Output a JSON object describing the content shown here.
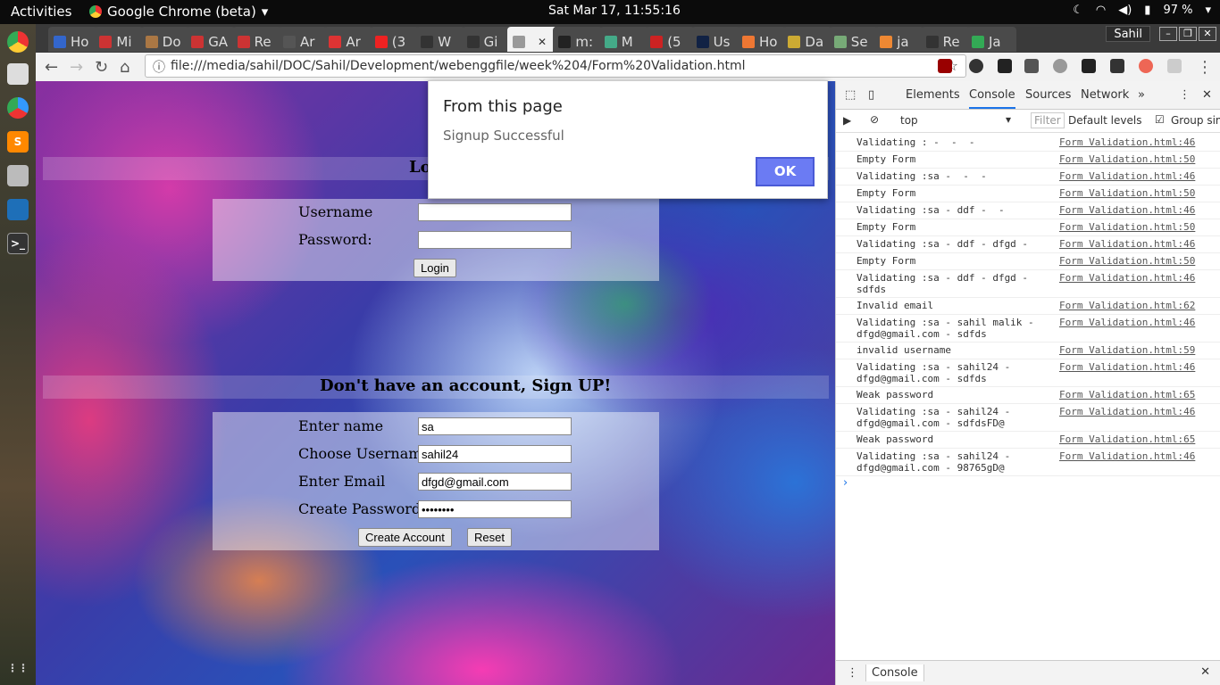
{
  "topbar": {
    "activities": "Activities",
    "app": "Google Chrome (beta)",
    "clock": "Sat Mar 17, 11:55:16",
    "battery": "97 %"
  },
  "browser": {
    "tabs": [
      {
        "label": "Ho"
      },
      {
        "label": "Mi"
      },
      {
        "label": "Do"
      },
      {
        "label": "GA"
      },
      {
        "label": "Re"
      },
      {
        "label": "Ar"
      },
      {
        "label": "Ar"
      },
      {
        "label": "(3"
      },
      {
        "label": "W"
      },
      {
        "label": "Gi"
      },
      {
        "label": ""
      },
      {
        "label": "m:"
      },
      {
        "label": "M"
      },
      {
        "label": "(5"
      },
      {
        "label": "Us"
      },
      {
        "label": "Ho"
      },
      {
        "label": "Da"
      },
      {
        "label": "Se"
      },
      {
        "label": "ja"
      },
      {
        "label": "Re"
      },
      {
        "label": "Ja"
      }
    ],
    "profile": "Sahil",
    "url": "file:///media/sahil/DOC/Sahil/Development/webenggfile/week%204/Form%20Validation.html"
  },
  "page": {
    "login_heading": "Lo",
    "username_label": "Username",
    "password_label": "Password:",
    "login_button": "Login",
    "signup_heading": "Don't have an account, Sign UP!",
    "name_label": "Enter name",
    "name_value": "sa",
    "choose_username_label": "Choose Username",
    "choose_username_value": "sahil24",
    "email_label": "Enter Email",
    "email_value": "dfgd@gmail.com",
    "create_password_label": "Create Password:",
    "create_password_value": "••••••••",
    "create_button": "Create Account",
    "reset_button": "Reset"
  },
  "dialog": {
    "title": "From this page",
    "message": "Signup Successful",
    "ok": "OK"
  },
  "devtools": {
    "tabs": [
      "Elements",
      "Console",
      "Sources",
      "Network"
    ],
    "context": "top",
    "filter": "Filter",
    "levels": "Default levels",
    "group": "Group sim",
    "logs": [
      {
        "msg": "Validating : -  -  -",
        "src": "Form Validation.html:46"
      },
      {
        "msg": "Empty Form",
        "src": "Form Validation.html:50"
      },
      {
        "msg": "Validating :sa -  -  -",
        "src": "Form Validation.html:46"
      },
      {
        "msg": "Empty Form",
        "src": "Form Validation.html:50"
      },
      {
        "msg": "Validating :sa - ddf -  -",
        "src": "Form Validation.html:46"
      },
      {
        "msg": "Empty Form",
        "src": "Form Validation.html:50"
      },
      {
        "msg": "Validating :sa - ddf - dfgd -",
        "src": "Form Validation.html:46"
      },
      {
        "msg": "Empty Form",
        "src": "Form Validation.html:50"
      },
      {
        "msg": "Validating :sa - ddf - dfgd -\nsdfds",
        "src": "Form Validation.html:46"
      },
      {
        "msg": "Invalid email",
        "src": "Form Validation.html:62"
      },
      {
        "msg": "Validating :sa - sahil malik -\ndfgd@gmail.com - sdfds",
        "src": "Form Validation.html:46"
      },
      {
        "msg": "invalid username",
        "src": "Form Validation.html:59"
      },
      {
        "msg": "Validating :sa - sahil24 -\ndfgd@gmail.com - sdfds",
        "src": "Form Validation.html:46"
      },
      {
        "msg": "Weak password",
        "src": "Form Validation.html:65"
      },
      {
        "msg": "Validating :sa - sahil24 -\ndfgd@gmail.com - sdfdsFD@",
        "src": "Form Validation.html:46"
      },
      {
        "msg": "Weak password",
        "src": "Form Validation.html:65"
      },
      {
        "msg": "Validating :sa - sahil24 -\ndfgd@gmail.com - 98765gD@",
        "src": "Form Validation.html:46"
      }
    ],
    "drawer": "Console"
  }
}
